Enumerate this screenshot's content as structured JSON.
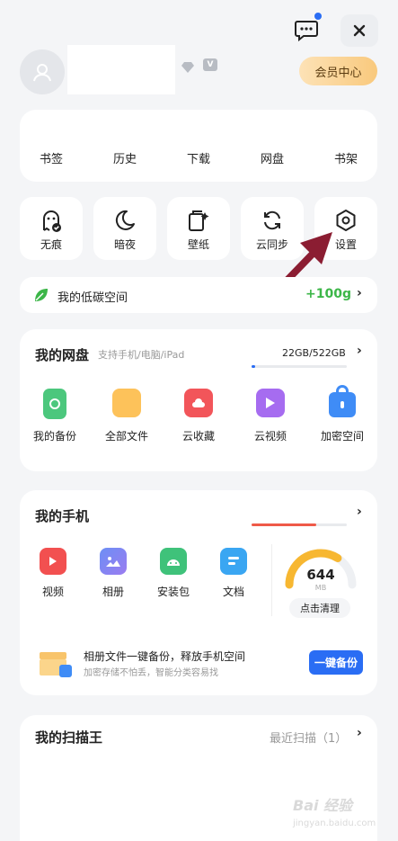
{
  "header": {
    "message_icon": "message-icon",
    "close_icon": "close-icon",
    "vip_badge": "V",
    "member_center_label": "会员中心"
  },
  "top_nav": {
    "items": [
      {
        "label": "书签"
      },
      {
        "label": "历史"
      },
      {
        "label": "下载"
      },
      {
        "label": "网盘"
      },
      {
        "label": "书架"
      }
    ]
  },
  "quick_actions": {
    "items": [
      {
        "label": "无痕",
        "icon": "incognito-icon"
      },
      {
        "label": "暗夜",
        "icon": "moon-icon"
      },
      {
        "label": "壁纸",
        "icon": "wallpaper-icon"
      },
      {
        "label": "云同步",
        "icon": "sync-icon"
      },
      {
        "label": "设置",
        "icon": "settings-icon"
      }
    ]
  },
  "low_carbon": {
    "label": "我的低碳空间",
    "value": "+100g",
    "accent": "#3cb648"
  },
  "cloud_disk": {
    "title": "我的网盘",
    "subtitle": "支持手机/电脑/iPad",
    "usage": "22GB/522GB",
    "usage_fraction": 0.042,
    "items": [
      {
        "label": "我的备份"
      },
      {
        "label": "全部文件"
      },
      {
        "label": "云收藏"
      },
      {
        "label": "云视频"
      },
      {
        "label": "加密空间"
      }
    ]
  },
  "my_phone": {
    "title": "我的手机",
    "storage_fraction": 0.68,
    "items": [
      {
        "label": "视频"
      },
      {
        "label": "相册"
      },
      {
        "label": "安装包"
      },
      {
        "label": "文档"
      }
    ],
    "gauge_value": "644",
    "gauge_unit": "MB",
    "clean_button": "点击清理",
    "backup_title": "相册文件一键备份，释放手机空间",
    "backup_subtitle": "加密存储不怕丢，智能分类容易找",
    "backup_button": "一键备份",
    "accent": "#2a6df4"
  },
  "scanner": {
    "title": "我的扫描王",
    "recent": "最近扫描（1）"
  },
  "watermark": {
    "text": "Bai 经验",
    "url": "jingyan.baidu.com"
  }
}
